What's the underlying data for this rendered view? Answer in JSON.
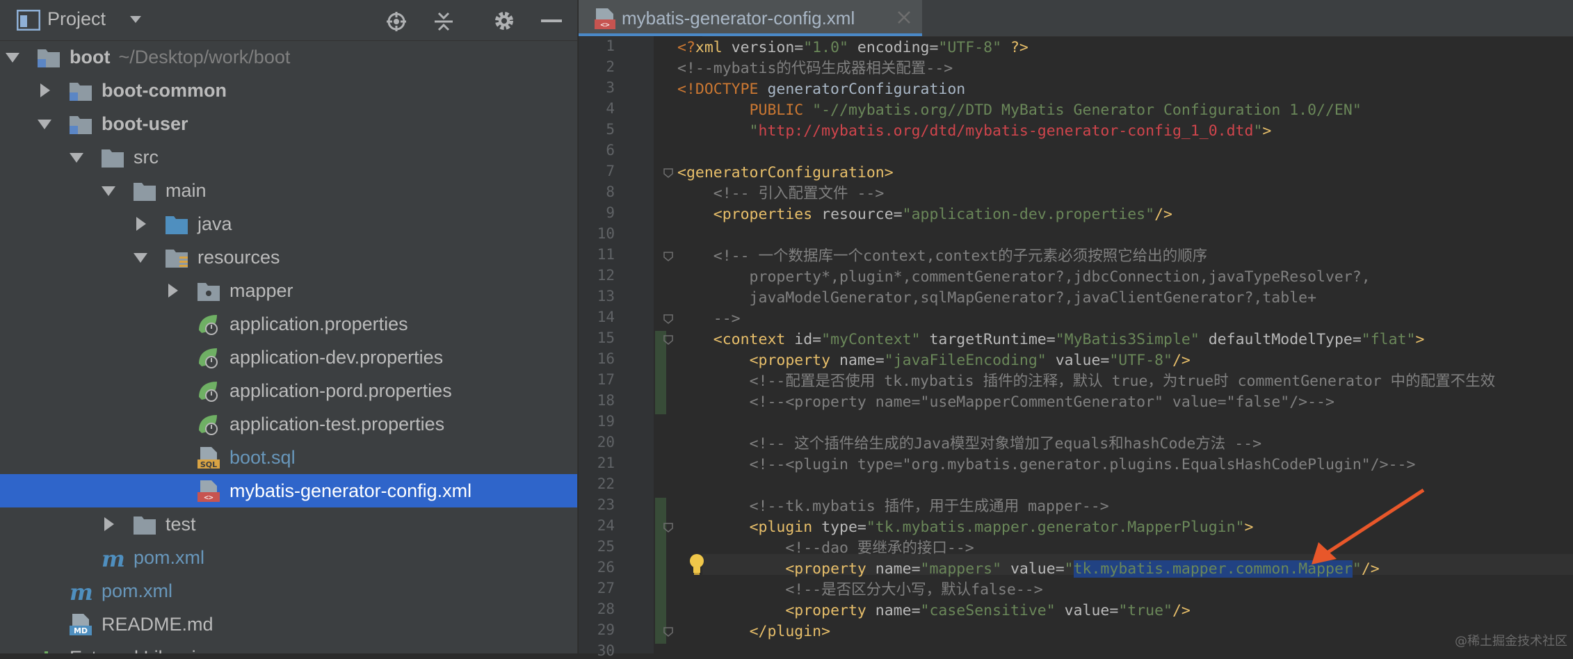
{
  "project_panel": {
    "title": "Project",
    "tree": [
      {
        "label": "boot",
        "path": "~/Desktop/work/boot",
        "bold": true,
        "expanded": true,
        "icon": "module-folder-icon"
      },
      {
        "label": "boot-common",
        "bold": true,
        "expanded": false,
        "icon": "module-folder-icon"
      },
      {
        "label": "boot-user",
        "bold": true,
        "expanded": true,
        "icon": "module-folder-icon"
      },
      {
        "label": "src",
        "expanded": true,
        "icon": "folder-icon"
      },
      {
        "label": "main",
        "expanded": true,
        "icon": "folder-icon"
      },
      {
        "label": "java",
        "expanded": false,
        "icon": "source-folder-icon"
      },
      {
        "label": "resources",
        "expanded": true,
        "icon": "resources-folder-icon"
      },
      {
        "label": "mapper",
        "expanded": false,
        "icon": "package-folder-icon"
      },
      {
        "label": "application.properties",
        "icon": "spring-properties-icon"
      },
      {
        "label": "application-dev.properties",
        "icon": "spring-properties-icon"
      },
      {
        "label": "application-pord.properties",
        "icon": "spring-properties-icon"
      },
      {
        "label": "application-test.properties",
        "icon": "spring-properties-icon"
      },
      {
        "label": "boot.sql",
        "icon": "sql-file-icon",
        "color": "blue"
      },
      {
        "label": "mybatis-generator-config.xml",
        "icon": "xml-file-icon",
        "selected": true
      },
      {
        "label": "test",
        "expanded": false,
        "icon": "folder-icon"
      },
      {
        "label": "pom.xml",
        "icon": "maven-icon",
        "color": "blue"
      },
      {
        "label": "pom.xml",
        "icon": "maven-icon",
        "color": "blue"
      },
      {
        "label": "README.md",
        "icon": "markdown-file-icon"
      },
      {
        "label": "External Libraries",
        "icon": "libraries-icon"
      }
    ]
  },
  "editor": {
    "tab": {
      "label": "mybatis-generator-config.xml"
    },
    "line_numbers": [
      "1",
      "2",
      "3",
      "4",
      "5",
      "6",
      "7",
      "8",
      "9",
      "10",
      "11",
      "12",
      "13",
      "14",
      "15",
      "16",
      "17",
      "18",
      "19",
      "20",
      "21",
      "22",
      "23",
      "24",
      "25",
      "26",
      "27",
      "28",
      "29",
      "30"
    ],
    "lines": [
      [
        [
          "kw",
          "<?"
        ],
        [
          "tag",
          "xml "
        ],
        [
          "attr",
          "version="
        ],
        [
          "val",
          "\"1.0\""
        ],
        [
          "attr",
          " encoding="
        ],
        [
          "val",
          "\"UTF-8\""
        ],
        [
          "tag",
          " ?>"
        ]
      ],
      [
        [
          "cmt",
          "<!--mybatis的代码生成器相关配置-->"
        ]
      ],
      [
        [
          "kw",
          "<!DOCTYPE "
        ],
        [
          "plain",
          "generatorConfiguration"
        ]
      ],
      [
        [
          "plain",
          "        "
        ],
        [
          "kw",
          "PUBLIC "
        ],
        [
          "val",
          "\"-//mybatis.org//DTD MyBatis Generator Configuration 1.0//EN\""
        ]
      ],
      [
        [
          "plain",
          "        "
        ],
        [
          "val",
          "\""
        ],
        [
          "url",
          "http://mybatis.org/dtd/mybatis-generator-config_1_0.dtd"
        ],
        [
          "val",
          "\""
        ],
        [
          "tag",
          ">"
        ]
      ],
      [],
      [
        [
          "tag",
          "<generatorConfiguration>"
        ]
      ],
      [
        [
          "plain",
          "    "
        ],
        [
          "cmt",
          "<!-- 引入配置文件 -->"
        ]
      ],
      [
        [
          "plain",
          "    "
        ],
        [
          "tag",
          "<properties "
        ],
        [
          "attr",
          "resource="
        ],
        [
          "val",
          "\"application-dev.properties\""
        ],
        [
          "tag",
          "/>"
        ]
      ],
      [],
      [
        [
          "plain",
          "    "
        ],
        [
          "cmt",
          "<!-- 一个数据库一个context,context的子元素必须按照它给出的顺序"
        ]
      ],
      [
        [
          "cmt",
          "        property*,plugin*,commentGenerator?,jdbcConnection,javaTypeResolver?,"
        ]
      ],
      [
        [
          "cmt",
          "        javaModelGenerator,sqlMapGenerator?,javaClientGenerator?,table+"
        ]
      ],
      [
        [
          "cmt",
          "    -->"
        ]
      ],
      [
        [
          "plain",
          "    "
        ],
        [
          "tag",
          "<context "
        ],
        [
          "attr",
          "id="
        ],
        [
          "val",
          "\"myContext\""
        ],
        [
          "attr",
          " targetRuntime="
        ],
        [
          "val",
          "\"MyBatis3Simple\""
        ],
        [
          "attr",
          " defaultModelType="
        ],
        [
          "val",
          "\"flat\""
        ],
        [
          "tag",
          ">"
        ]
      ],
      [
        [
          "plain",
          "        "
        ],
        [
          "tag",
          "<property "
        ],
        [
          "attr",
          "name="
        ],
        [
          "val",
          "\"javaFileEncoding\""
        ],
        [
          "attr",
          " value="
        ],
        [
          "val",
          "\"UTF-8\""
        ],
        [
          "tag",
          "/>"
        ]
      ],
      [
        [
          "plain",
          "        "
        ],
        [
          "cmt",
          "<!--配置是否使用 tk.mybatis 插件的注释，默认 true，为true时 commentGenerator 中的配置不生效"
        ]
      ],
      [
        [
          "plain",
          "        "
        ],
        [
          "cmt",
          "<!--<property name=\"useMapperCommentGenerator\" value=\"false\"/>-->"
        ]
      ],
      [],
      [
        [
          "plain",
          "        "
        ],
        [
          "cmt",
          "<!-- 这个插件给生成的Java模型对象增加了equals和hashCode方法 -->"
        ]
      ],
      [
        [
          "plain",
          "        "
        ],
        [
          "cmt",
          "<!--<plugin type=\"org.mybatis.generator.plugins.EqualsHashCodePlugin\"/>-->"
        ]
      ],
      [],
      [
        [
          "plain",
          "        "
        ],
        [
          "cmt",
          "<!--tk.mybatis 插件，用于生成通用 mapper-->"
        ]
      ],
      [
        [
          "plain",
          "        "
        ],
        [
          "tag",
          "<plugin "
        ],
        [
          "attr",
          "type="
        ],
        [
          "val",
          "\"tk.mybatis.mapper.generator.MapperPlugin\""
        ],
        [
          "tag",
          ">"
        ]
      ],
      [
        [
          "plain",
          "            "
        ],
        [
          "cmt",
          "<!--dao 要继承的接口-->"
        ]
      ],
      [
        [
          "plain",
          "            "
        ],
        [
          "tag",
          "<property "
        ],
        [
          "attr",
          "name="
        ],
        [
          "val",
          "\"mappers\""
        ],
        [
          "attr",
          " value="
        ],
        [
          "val",
          "\""
        ],
        [
          "sel",
          "tk.mybatis.mapper.common.Mapper"
        ],
        [
          "val",
          "\""
        ],
        [
          "tag",
          "/>"
        ]
      ],
      [
        [
          "plain",
          "            "
        ],
        [
          "cmt",
          "<!--是否区分大小写，默认false-->"
        ]
      ],
      [
        [
          "plain",
          "            "
        ],
        [
          "tag",
          "<property "
        ],
        [
          "attr",
          "name="
        ],
        [
          "val",
          "\"caseSensitive\""
        ],
        [
          "attr",
          " value="
        ],
        [
          "val",
          "\"true\""
        ],
        [
          "tag",
          "/>"
        ]
      ],
      [
        [
          "plain",
          "        "
        ],
        [
          "tag",
          "</plugin>"
        ]
      ],
      []
    ]
  },
  "watermark": "@稀土掘金技术社区"
}
